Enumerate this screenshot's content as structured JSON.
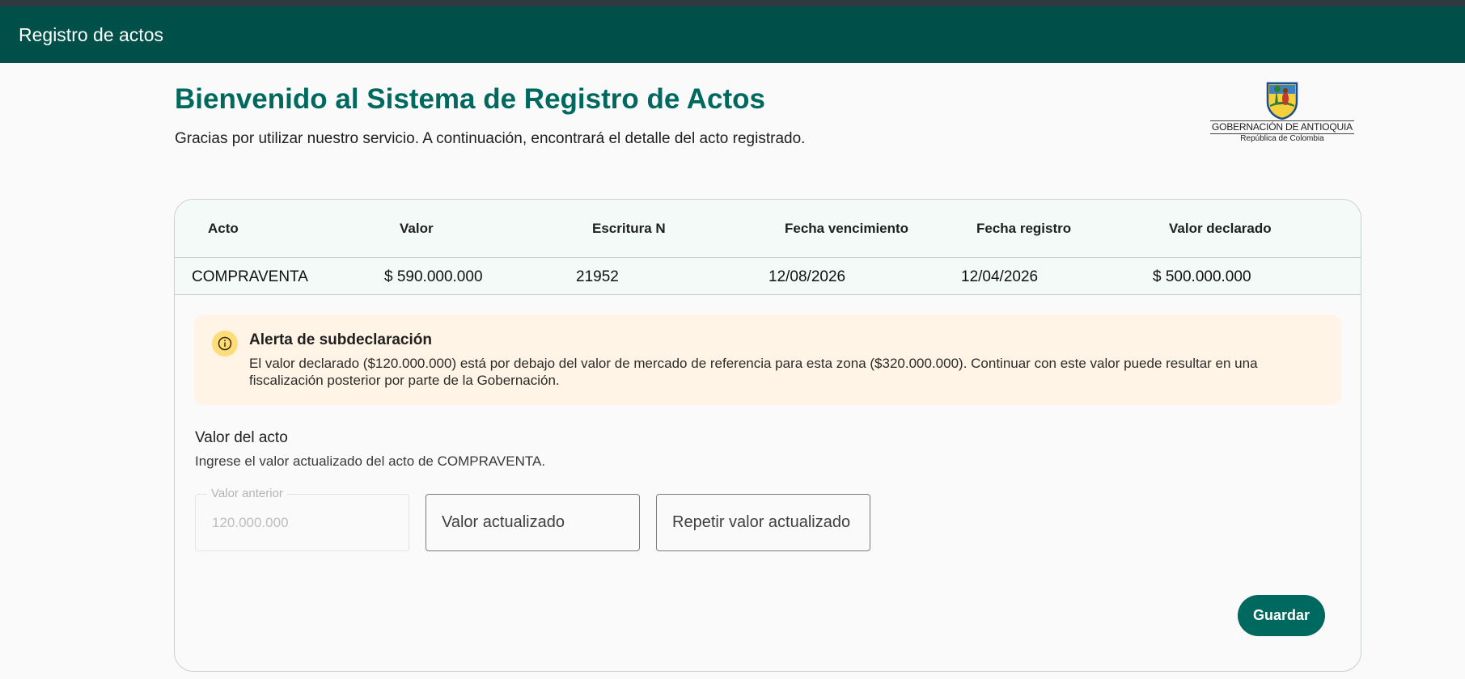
{
  "app_bar": {
    "title": "Registro de actos"
  },
  "header": {
    "title": "Bienvenido al Sistema de Registro de Actos",
    "subtitle": "Gracias por utilizar nuestro servicio. A continuación, encontrará el detalle del acto registrado."
  },
  "logo": {
    "name": "GOBERNACIÓN DE ANTIOQUIA",
    "country": "República de Colombia"
  },
  "table": {
    "columns": [
      "Acto",
      "Valor",
      "Escritura N",
      "Fecha vencimiento",
      "Fecha registro",
      "Valor declarado"
    ],
    "rows": [
      [
        "COMPRAVENTA",
        "$ 590.000.000",
        "21952",
        "12/08/2026",
        "12/04/2026",
        "$ 500.000.000"
      ]
    ]
  },
  "alert": {
    "icon": "info-icon",
    "title": "Alerta de subdeclaración",
    "message": "El valor declarado ($120.000.000) está por debajo del valor de mercado de referencia para esta zona ($320.000.000). Continuar con este valor puede resultar en una fiscalización posterior por parte de la Gobernación."
  },
  "form": {
    "title": "Valor del acto",
    "description": "Ingrese el valor actualizado del acto de COMPRAVENTA.",
    "previous_value": {
      "label": "Valor anterior",
      "value": "120.000.000"
    },
    "updated_value": {
      "placeholder": "Valor actualizado",
      "value": ""
    },
    "repeat_value": {
      "placeholder": "Repetir valor actualizado",
      "value": ""
    },
    "save_label": "Guardar"
  },
  "colors": {
    "app_bar": "#00504a",
    "accent": "#00695f",
    "alert_background": "#fff4e5",
    "alert_icon": "#fddc7a"
  }
}
